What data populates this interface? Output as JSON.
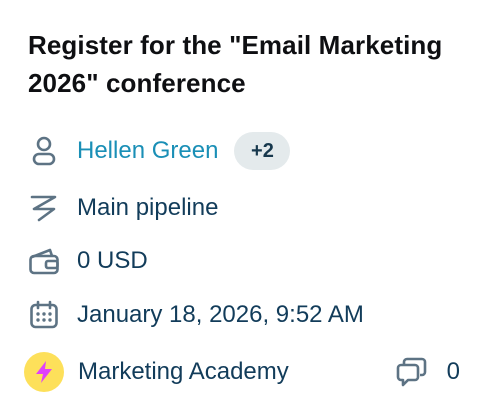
{
  "deal": {
    "title": "Register for the \"Email Marketing 2026\" conference",
    "owner": {
      "icon": "person-icon",
      "name": "Hellen Green",
      "extra_count": "+2"
    },
    "pipeline": {
      "icon": "pipeline-icon",
      "name": "Main pipeline"
    },
    "amount": {
      "icon": "wallet-icon",
      "value": "0 USD"
    },
    "date": {
      "icon": "calendar-icon",
      "value": "January 18, 2026, 9:52 AM"
    },
    "company": {
      "icon": "lightning-icon",
      "name": "Marketing Academy",
      "avatar_color": "#fde05a",
      "avatar_icon_color": "#e040fb"
    },
    "comments": {
      "icon": "comments-icon",
      "count": "0"
    }
  },
  "colors": {
    "link": "#1a8fb6",
    "text": "#123c5a",
    "icon": "#5d7384",
    "chip_bg": "#e4eaec"
  }
}
